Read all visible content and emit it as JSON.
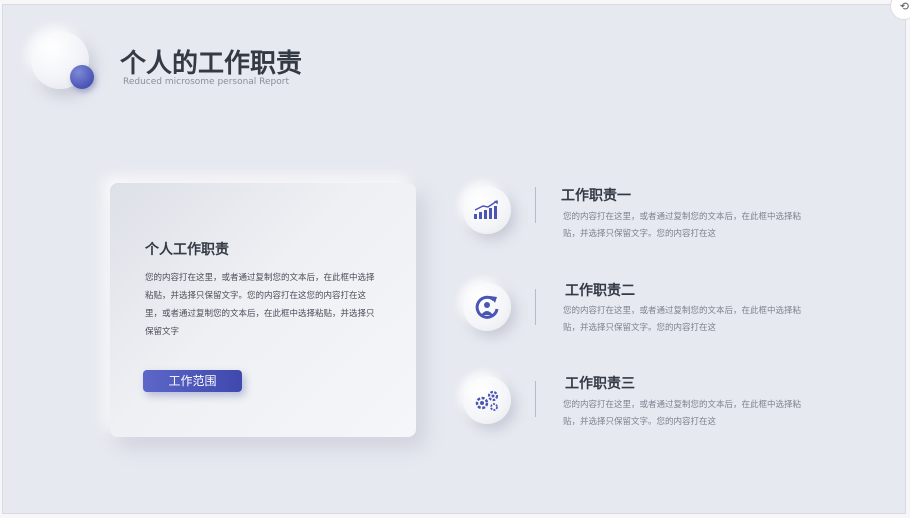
{
  "slide": {
    "title": "个人的工作职责",
    "subtitle": "Reduced microsome personal Report"
  },
  "card": {
    "title": "个人工作职责",
    "body": "您的内容打在这里，或者通过复制您的文本后，在此框中选择粘贴，并选择只保留文字。您的内容打在这您的内容打在这里，或者通过复制您的文本后，在此框中选择粘贴，并选择只保留文字",
    "button_label": "工作范围"
  },
  "duties": [
    {
      "title": "工作职责一",
      "desc": "您的内容打在这里，或者通过复制您的文本后，在此框中选择粘贴，并选择只保留文字。您的内容打在这",
      "icon": "growth-chart-icon"
    },
    {
      "title": "工作职责二",
      "desc": "您的内容打在这里，或者通过复制您的文本后，在此框中选择粘贴，并选择只保留文字。您的内容打在这",
      "icon": "person-cycle-icon"
    },
    {
      "title": "工作职责三",
      "desc": "您的内容打在这里，或者通过复制您的文本后，在此框中选择粘贴，并选择只保留文字。您的内容打在这",
      "icon": "gears-icon"
    }
  ],
  "colors": {
    "accent": "#4a55b5",
    "background": "#e7e9f0",
    "title_text": "#333a44"
  }
}
